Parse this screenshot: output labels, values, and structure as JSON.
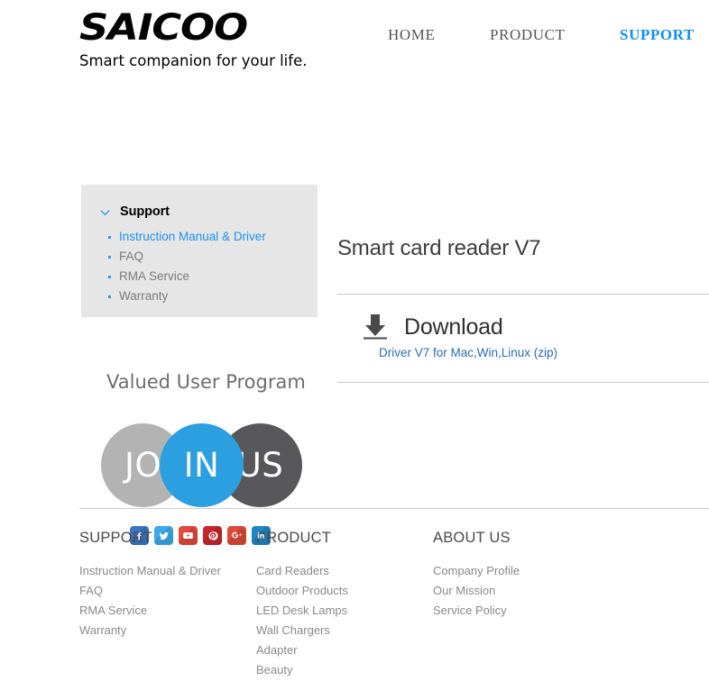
{
  "brand": {
    "logo_text": "SAICOO",
    "tagline": "Smart companion for your life.",
    "accent_blue": "#138df5",
    "link_blue": "#2a6eb5"
  },
  "nav": {
    "items": [
      {
        "label": "HOME",
        "active": false
      },
      {
        "label": "PRODUCT",
        "active": false
      },
      {
        "label": "SUPPORT",
        "active": true
      }
    ]
  },
  "sidebar": {
    "title": "Support",
    "items": [
      {
        "label": "Instruction Manual & Driver",
        "active": true
      },
      {
        "label": "FAQ",
        "active": false
      },
      {
        "label": "RMA Service",
        "active": false
      },
      {
        "label": "Warranty",
        "active": false
      }
    ]
  },
  "valued_user_program": {
    "title": "Valued User Program",
    "circles": [
      {
        "text": "JO",
        "color": "#b3b3b3"
      },
      {
        "text": "IN",
        "color": "#2b9fdf"
      },
      {
        "text": "US",
        "color": "#58585a"
      }
    ],
    "social": [
      {
        "name": "facebook",
        "color": "#3b76c4"
      },
      {
        "name": "twitter",
        "color": "#3aabe8"
      },
      {
        "name": "youtube",
        "color": "#e24b3b"
      },
      {
        "name": "pinterest",
        "color": "#c6262e"
      },
      {
        "name": "googleplus",
        "color": "#dd4b39"
      },
      {
        "name": "linkedin",
        "color": "#1f86c4"
      }
    ]
  },
  "content": {
    "title": "Smart card reader V7",
    "download_label": "Download",
    "download_link": "Driver V7 for Mac,Win,Linux (zip)"
  },
  "footer": {
    "columns": [
      {
        "heading": "SUPPORT",
        "links": [
          "Instruction Manual & Driver",
          "FAQ",
          "RMA Service",
          "Warranty"
        ]
      },
      {
        "heading": "PRODUCT",
        "links": [
          "Card Readers",
          "Outdoor Products",
          "LED Desk Lamps",
          "Wall Chargers",
          "Adapter",
          "Beauty"
        ]
      },
      {
        "heading": "ABOUT US",
        "links": [
          "Company Profile",
          "Our Mission",
          "Service Policy"
        ]
      }
    ]
  }
}
